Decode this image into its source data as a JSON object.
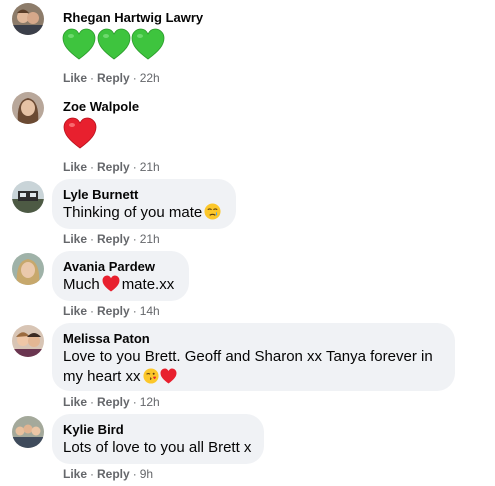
{
  "comments": [
    {
      "name": "Rhegan Hartwig Lawry",
      "text": "",
      "like": "Like",
      "reply": "Reply",
      "time": "22h",
      "reaction": "green-heart-x3"
    },
    {
      "name": "Zoe Walpole",
      "text": "",
      "like": "Like",
      "reply": "Reply",
      "time": "21h",
      "reaction": "red-heart"
    },
    {
      "name": "Lyle Burnett",
      "text": "Thinking of you mate",
      "like": "Like",
      "reply": "Reply",
      "time": "21h"
    },
    {
      "name": "Avania Pardew",
      "text_before": "Much",
      "text_after": "mate.xx",
      "like": "Like",
      "reply": "Reply",
      "time": "14h"
    },
    {
      "name": "Melissa Paton",
      "text_line1": "Love to you Brett. Geoff and Sharon xx Tanya forever in",
      "text_line2": "my heart xx",
      "like": "Like",
      "reply": "Reply",
      "time": "12h"
    },
    {
      "name": "Kylie Bird",
      "text": "Lots of love to you all Brett x",
      "like": "Like",
      "reply": "Reply",
      "time": "9h"
    }
  ],
  "colors": {
    "bubble": "#f0f2f5",
    "meta": "#65676b",
    "green": "#3ec43e",
    "red": "#e8202e"
  }
}
